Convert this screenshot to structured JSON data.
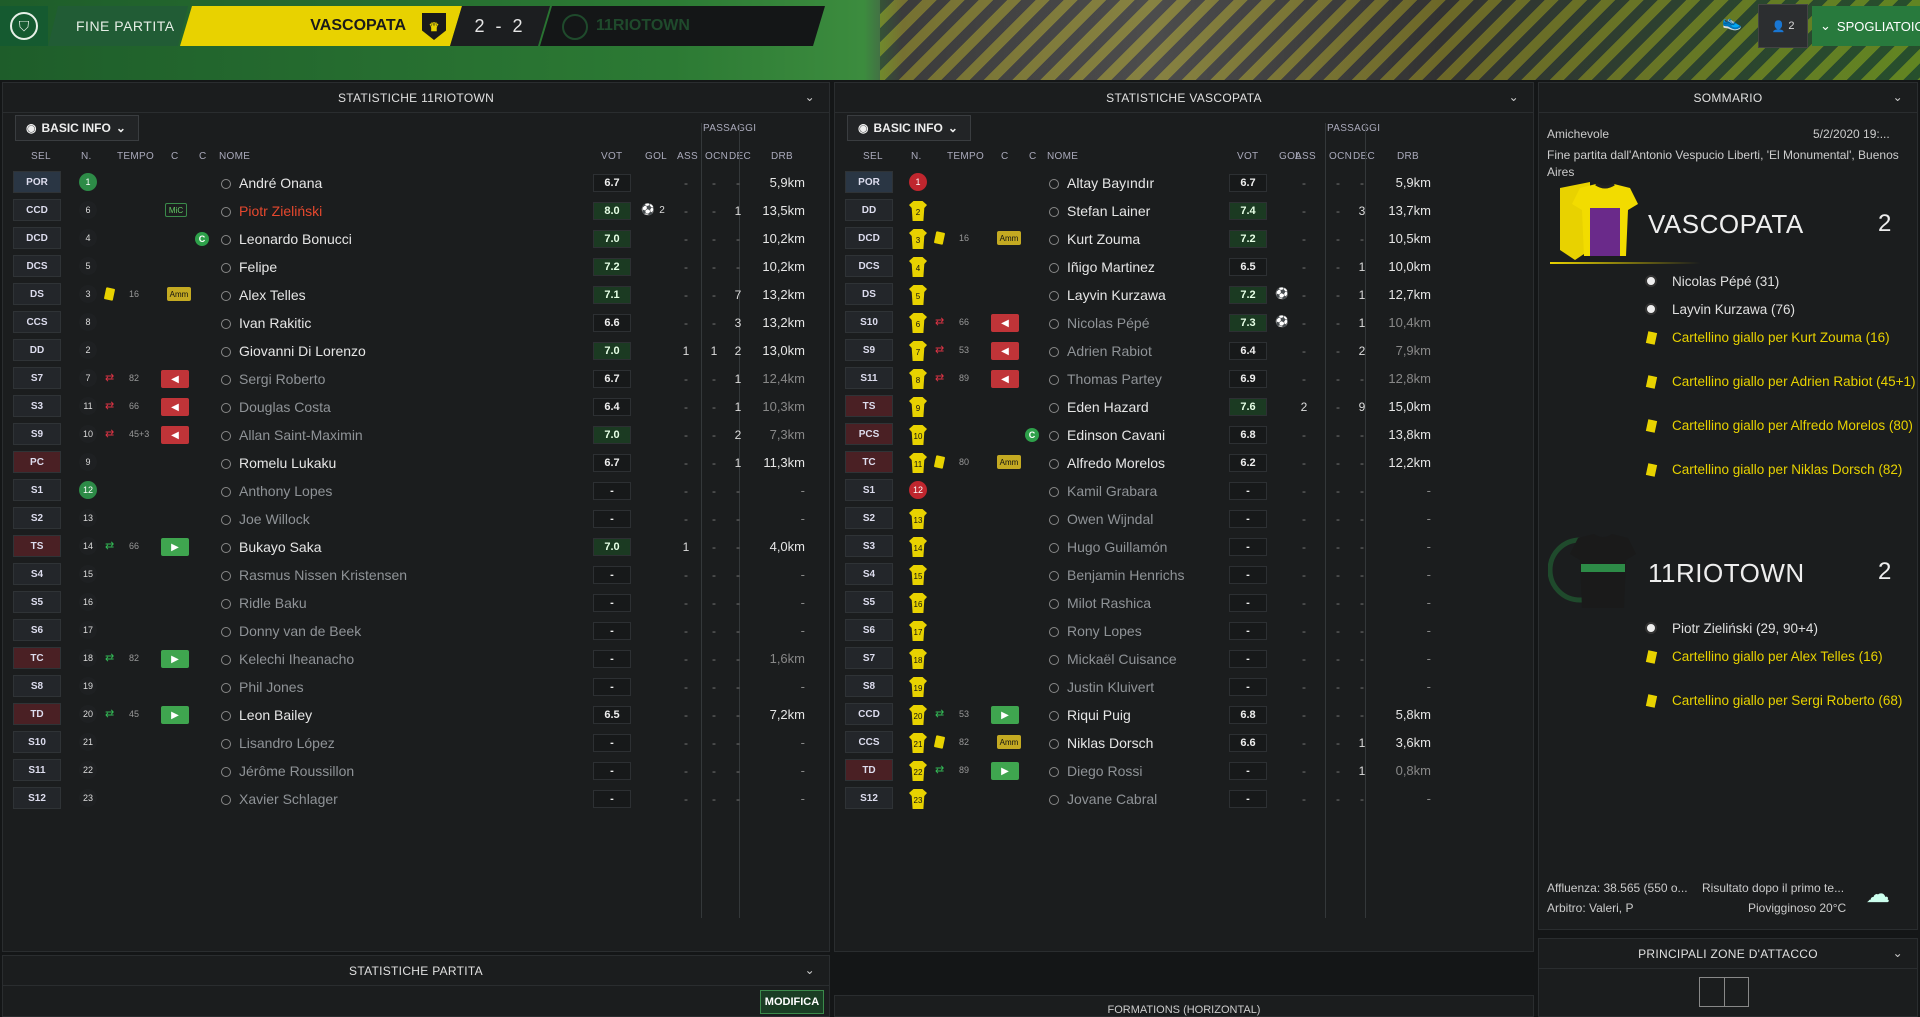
{
  "header": {
    "title": "FINE PARTITA",
    "home_team": "VASCOPATA",
    "score": "2 - 2",
    "away_team": "11RIOTOWN",
    "notif_count": "2",
    "spogliatoio": "SPOGLIATOIO"
  },
  "left_panel": {
    "title": "STATISTICHE 11RIOTOWN",
    "view_button": "BASIC INFO",
    "group_header": "PASSAGGI",
    "columns": {
      "sel": "SEL",
      "n": "N.",
      "tempo": "TEMPO",
      "c1": "C",
      "c2": "C",
      "nome": "NOME",
      "vot": "VOT",
      "gol": "GOL",
      "ass": "ASS",
      "ocn": "OCN",
      "dec": "DEC",
      "drb": "DRB"
    },
    "rows": [
      {
        "pos": "POR",
        "n": "1",
        "name": "André Onana",
        "vot": "6.7",
        "gol": "",
        "ass": "-",
        "ocn": "-",
        "dec": "-",
        "drb": "5,9km"
      },
      {
        "pos": "CCD",
        "n": "6",
        "name": "Piotr Zieliński",
        "vot": "8.0",
        "gol": "2",
        "ass": "-",
        "ocn": "-",
        "dec": "1",
        "drb": "13,5km",
        "badge": "MiC"
      },
      {
        "pos": "DCD",
        "n": "4",
        "name": "Leonardo Bonucci",
        "vot": "7.0",
        "gol": "",
        "ass": "-",
        "ocn": "-",
        "dec": "-",
        "drb": "10,2km"
      },
      {
        "pos": "DCS",
        "n": "5",
        "name": "Felipe",
        "vot": "7.2",
        "gol": "",
        "ass": "-",
        "ocn": "-",
        "dec": "-",
        "drb": "10,2km"
      },
      {
        "pos": "DS",
        "n": "3",
        "name": "Alex Telles",
        "vot": "7.1",
        "gol": "",
        "ass": "-",
        "ocn": "-",
        "dec": "7",
        "drb": "13,2km",
        "minute": "16",
        "amm": "Amm"
      },
      {
        "pos": "CCS",
        "n": "8",
        "name": "Ivan Rakitic",
        "vot": "6.6",
        "gol": "",
        "ass": "-",
        "ocn": "-",
        "dec": "3",
        "drb": "13,2km"
      },
      {
        "pos": "DD",
        "n": "2",
        "name": "Giovanni Di Lorenzo",
        "vot": "7.0",
        "gol": "",
        "ass": "1",
        "ocn": "1",
        "dec": "2",
        "drb": "13,0km"
      },
      {
        "pos": "S7",
        "n": "7",
        "name": "Sergi Roberto",
        "vot": "6.7",
        "gol": "",
        "ass": "-",
        "ocn": "-",
        "dec": "1",
        "drb": "12,4km",
        "minute": "82"
      },
      {
        "pos": "S3",
        "n": "11",
        "name": "Douglas Costa",
        "vot": "6.4",
        "gol": "",
        "ass": "-",
        "ocn": "-",
        "dec": "1",
        "drb": "10,3km",
        "minute": "66"
      },
      {
        "pos": "S9",
        "n": "10",
        "name": "Allan Saint-Maximin",
        "vot": "7.0",
        "gol": "",
        "ass": "-",
        "ocn": "-",
        "dec": "2",
        "drb": "7,3km",
        "minute": "45+3"
      },
      {
        "pos": "PC",
        "n": "9",
        "name": "Romelu Lukaku",
        "vot": "6.7",
        "gol": "",
        "ass": "-",
        "ocn": "-",
        "dec": "1",
        "drb": "11,3km"
      },
      {
        "pos": "S1",
        "n": "12",
        "name": "Anthony Lopes",
        "vot": "-",
        "gol": "",
        "ass": "-",
        "ocn": "-",
        "dec": "-",
        "drb": "-"
      },
      {
        "pos": "S2",
        "n": "13",
        "name": "Joe Willock",
        "vot": "-",
        "gol": "",
        "ass": "-",
        "ocn": "-",
        "dec": "-",
        "drb": "-"
      },
      {
        "pos": "TS",
        "n": "14",
        "name": "Bukayo Saka",
        "vot": "7.0",
        "gol": "",
        "ass": "1",
        "ocn": "-",
        "dec": "-",
        "drb": "4,0km",
        "minute": "66"
      },
      {
        "pos": "S4",
        "n": "15",
        "name": "Rasmus Nissen Kristensen",
        "vot": "-",
        "gol": "",
        "ass": "-",
        "ocn": "-",
        "dec": "-",
        "drb": "-"
      },
      {
        "pos": "S5",
        "n": "16",
        "name": "Ridle Baku",
        "vot": "-",
        "gol": "",
        "ass": "-",
        "ocn": "-",
        "dec": "-",
        "drb": "-"
      },
      {
        "pos": "S6",
        "n": "17",
        "name": "Donny van de Beek",
        "vot": "-",
        "gol": "",
        "ass": "-",
        "ocn": "-",
        "dec": "-",
        "drb": "-"
      },
      {
        "pos": "TC",
        "n": "18",
        "name": "Kelechi Iheanacho",
        "vot": "-",
        "gol": "",
        "ass": "-",
        "ocn": "-",
        "dec": "-",
        "drb": "1,6km",
        "minute": "82"
      },
      {
        "pos": "S8",
        "n": "19",
        "name": "Phil Jones",
        "vot": "-",
        "gol": "",
        "ass": "-",
        "ocn": "-",
        "dec": "-",
        "drb": "-"
      },
      {
        "pos": "TD",
        "n": "20",
        "name": "Leon Bailey",
        "vot": "6.5",
        "gol": "",
        "ass": "-",
        "ocn": "-",
        "dec": "-",
        "drb": "7,2km",
        "minute": "45"
      },
      {
        "pos": "S10",
        "n": "21",
        "name": "Lisandro López",
        "vot": "-",
        "gol": "",
        "ass": "-",
        "ocn": "-",
        "dec": "-",
        "drb": "-"
      },
      {
        "pos": "S11",
        "n": "22",
        "name": "Jérôme Roussillon",
        "vot": "-",
        "gol": "",
        "ass": "-",
        "ocn": "-",
        "dec": "-",
        "drb": "-"
      },
      {
        "pos": "S12",
        "n": "23",
        "name": "Xavier Schlager",
        "vot": "-",
        "gol": "",
        "ass": "-",
        "ocn": "-",
        "dec": "-",
        "drb": "-"
      }
    ]
  },
  "mid_panel": {
    "title": "STATISTICHE VASCOPATA",
    "view_button": "BASIC INFO",
    "group_header": "PASSAGGI",
    "columns": {
      "sel": "SEL",
      "n": "N.",
      "tempo": "TEMPO",
      "c1": "C",
      "c2": "C",
      "nome": "NOME",
      "vot": "VOT",
      "gol": "GOL",
      "ass": "ASS",
      "ocn": "OCN",
      "dec": "DEC",
      "drb": "DRB"
    },
    "rows": [
      {
        "pos": "POR",
        "n": "1",
        "name": "Altay Bayındır",
        "vot": "6.7",
        "gol": "",
        "ass": "-",
        "ocn": "-",
        "dec": "-",
        "drb": "5,9km"
      },
      {
        "pos": "DD",
        "n": "2",
        "name": "Stefan Lainer",
        "vot": "7.4",
        "gol": "",
        "ass": "-",
        "ocn": "-",
        "dec": "3",
        "drb": "13,7km"
      },
      {
        "pos": "DCD",
        "n": "3",
        "name": "Kurt Zouma",
        "vot": "7.2",
        "gol": "",
        "ass": "-",
        "ocn": "-",
        "dec": "-",
        "drb": "10,5km",
        "minute": "16",
        "amm": "Amm"
      },
      {
        "pos": "DCS",
        "n": "4",
        "name": "Iñigo Martinez",
        "vot": "6.5",
        "gol": "",
        "ass": "-",
        "ocn": "-",
        "dec": "1",
        "drb": "10,0km"
      },
      {
        "pos": "DS",
        "n": "5",
        "name": "Layvin Kurzawa",
        "vot": "7.2",
        "gol": "1",
        "ass": "-",
        "ocn": "-",
        "dec": "1",
        "drb": "12,7km"
      },
      {
        "pos": "S10",
        "n": "6",
        "name": "Nicolas Pépé",
        "vot": "7.3",
        "gol": "1",
        "ass": "-",
        "ocn": "-",
        "dec": "1",
        "drb": "10,4km",
        "minute": "66"
      },
      {
        "pos": "S9",
        "n": "7",
        "name": "Adrien Rabiot",
        "vot": "6.4",
        "gol": "",
        "ass": "-",
        "ocn": "-",
        "dec": "2",
        "drb": "7,9km",
        "minute": "53"
      },
      {
        "pos": "S11",
        "n": "8",
        "name": "Thomas Partey",
        "vot": "6.9",
        "gol": "",
        "ass": "-",
        "ocn": "-",
        "dec": "-",
        "drb": "12,8km",
        "minute": "89"
      },
      {
        "pos": "TS",
        "n": "9",
        "name": "Eden Hazard",
        "vot": "7.6",
        "gol": "",
        "ass": "2",
        "ocn": "-",
        "dec": "9",
        "drb": "15,0km"
      },
      {
        "pos": "PCS",
        "n": "10",
        "name": "Edinson Cavani",
        "vot": "6.8",
        "gol": "",
        "ass": "-",
        "ocn": "-",
        "dec": "-",
        "drb": "13,8km"
      },
      {
        "pos": "TC",
        "n": "11",
        "name": "Alfredo Morelos",
        "vot": "6.2",
        "gol": "",
        "ass": "-",
        "ocn": "-",
        "dec": "-",
        "drb": "12,2km",
        "minute": "80",
        "amm": "Amm"
      },
      {
        "pos": "S1",
        "n": "12",
        "name": "Kamil Grabara",
        "vot": "-",
        "gol": "",
        "ass": "-",
        "ocn": "-",
        "dec": "-",
        "drb": "-"
      },
      {
        "pos": "S2",
        "n": "13",
        "name": "Owen Wijndal",
        "vot": "-",
        "gol": "",
        "ass": "-",
        "ocn": "-",
        "dec": "-",
        "drb": "-"
      },
      {
        "pos": "S3",
        "n": "14",
        "name": "Hugo Guillamón",
        "vot": "-",
        "gol": "",
        "ass": "-",
        "ocn": "-",
        "dec": "-",
        "drb": "-"
      },
      {
        "pos": "S4",
        "n": "15",
        "name": "Benjamin Henrichs",
        "vot": "-",
        "gol": "",
        "ass": "-",
        "ocn": "-",
        "dec": "-",
        "drb": "-"
      },
      {
        "pos": "S5",
        "n": "16",
        "name": "Milot Rashica",
        "vot": "-",
        "gol": "",
        "ass": "-",
        "ocn": "-",
        "dec": "-",
        "drb": "-"
      },
      {
        "pos": "S6",
        "n": "17",
        "name": "Rony Lopes",
        "vot": "-",
        "gol": "",
        "ass": "-",
        "ocn": "-",
        "dec": "-",
        "drb": "-"
      },
      {
        "pos": "S7",
        "n": "18",
        "name": "Mickaël Cuisance",
        "vot": "-",
        "gol": "",
        "ass": "-",
        "ocn": "-",
        "dec": "-",
        "drb": "-"
      },
      {
        "pos": "S8",
        "n": "19",
        "name": "Justin Kluivert",
        "vot": "-",
        "gol": "",
        "ass": "-",
        "ocn": "-",
        "dec": "-",
        "drb": "-"
      },
      {
        "pos": "CCD",
        "n": "20",
        "name": "Riqui Puig",
        "vot": "6.8",
        "gol": "",
        "ass": "-",
        "ocn": "-",
        "dec": "-",
        "drb": "5,8km",
        "minute": "53"
      },
      {
        "pos": "CCS",
        "n": "21",
        "name": "Niklas Dorsch",
        "vot": "6.6",
        "gol": "",
        "ass": "-",
        "ocn": "-",
        "dec": "1",
        "drb": "3,6km",
        "minute": "82",
        "amm": "Amm"
      },
      {
        "pos": "TD",
        "n": "22",
        "name": "Diego Rossi",
        "vot": "-",
        "gol": "",
        "ass": "-",
        "ocn": "-",
        "dec": "1",
        "drb": "0,8km",
        "minute": "89"
      },
      {
        "pos": "S12",
        "n": "23",
        "name": "Jovane Cabral",
        "vot": "-",
        "gol": "",
        "ass": "-",
        "ocn": "-",
        "dec": "-",
        "drb": "-"
      }
    ]
  },
  "summary": {
    "title": "SOMMARIO",
    "match_type": "Amichevole",
    "datetime": "5/2/2020 19:...",
    "venue": "Fine partita dall'Antonio Vespucio Liberti, 'El Monumental', Buenos Aires",
    "home": {
      "name": "VASCOPATA",
      "score": "2",
      "events": [
        {
          "type": "goal",
          "text": "Nicolas Pépé (31)"
        },
        {
          "type": "goal",
          "text": "Layvin Kurzawa (76)"
        },
        {
          "type": "card",
          "text": "Cartellino giallo per Kurt Zouma (16)"
        },
        {
          "type": "card",
          "text": "Cartellino giallo per Adrien Rabiot (45+1)"
        },
        {
          "type": "card",
          "text": "Cartellino giallo per Alfredo Morelos (80)"
        },
        {
          "type": "card",
          "text": "Cartellino giallo per Niklas Dorsch (82)"
        }
      ]
    },
    "away": {
      "name": "11RIOTOWN",
      "score": "2",
      "events": [
        {
          "type": "goal",
          "text": "Piotr Zieliński (29, 90+4)"
        },
        {
          "type": "card",
          "text": "Cartellino giallo per Alex Telles (16)"
        },
        {
          "type": "card",
          "text": "Cartellino giallo per Sergi Roberto (68)"
        }
      ]
    },
    "attendance": "Affluenza: 38.565 (550 o...",
    "result_note": "Risultato dopo il primo te...",
    "referee": "Arbitro: Valeri, P",
    "weather": "Piovigginoso 20°C",
    "zones_title": "PRINCIPALI ZONE D'ATTACCO"
  },
  "bottom": {
    "match_stats_title": "STATISTICHE PARTITA",
    "modifica": "MODIFICA",
    "formations_title": "FORMATIONS (HORIZONTAL)"
  },
  "colors": {
    "accent_green": "#2d8b47",
    "yellow": "#e8d200",
    "red": "#c0262e"
  }
}
